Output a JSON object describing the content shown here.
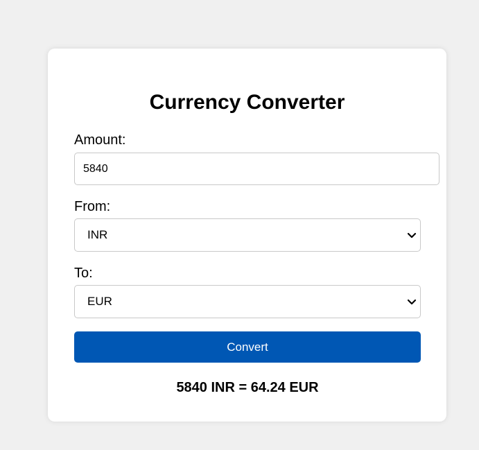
{
  "converter": {
    "title": "Currency Converter",
    "amount_label": "Amount:",
    "amount_value": "5840",
    "from_label": "From:",
    "from_selected": "INR",
    "to_label": "To:",
    "to_selected": "EUR",
    "convert_button": "Convert",
    "result": "5840 INR = 64.24 EUR"
  },
  "colors": {
    "page_background": "#f0f0f0",
    "card_background": "#ffffff",
    "button_background": "#0057b4",
    "button_text": "#ffffff",
    "border": "#c8c8c8"
  },
  "icons": {
    "select_arrow": "chevron-down-icon"
  }
}
